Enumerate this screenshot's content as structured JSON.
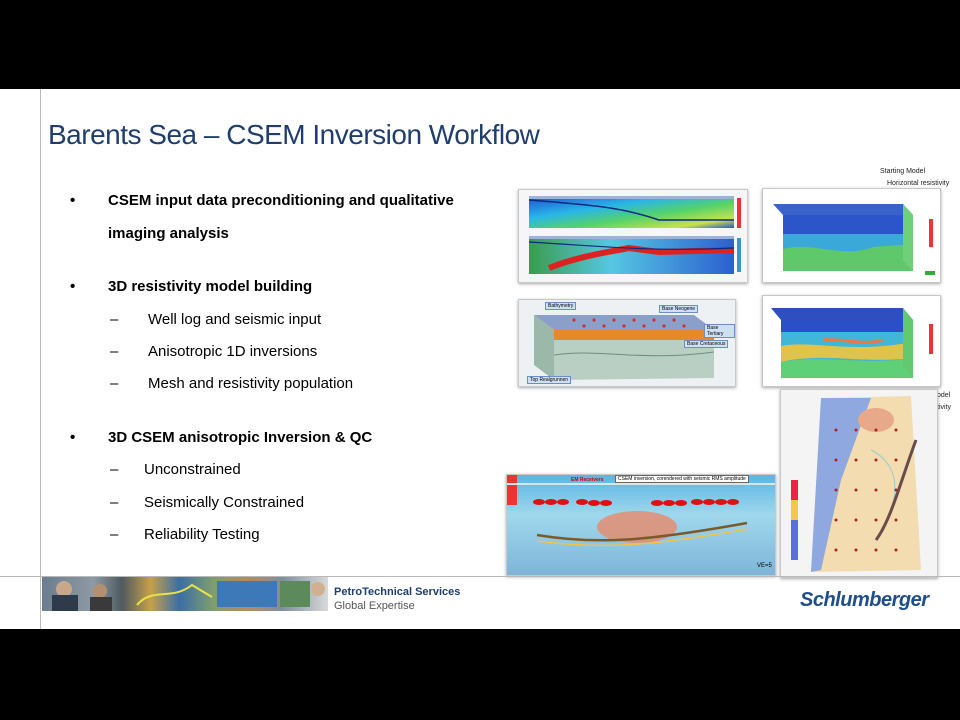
{
  "slide": {
    "title": "Barents Sea – CSEM Inversion Workflow",
    "bullet_marker": "•",
    "dash_marker": "–",
    "bullets": [
      {
        "line1": "CSEM input data preconditioning and qualitative",
        "line2": "imaging analysis"
      },
      {
        "text": "3D resistivity model building",
        "sub": [
          "Well log and seismic input",
          "Anisotropic 1D inversions",
          "Mesh and resistivity population"
        ]
      },
      {
        "text": "3D CSEM anisotropic Inversion & QC",
        "sub": [
          "Unconstrained",
          "Seismically Constrained",
          "Reliability Testing"
        ]
      }
    ]
  },
  "figures": {
    "starting_model_label": "Starting Model",
    "horizontal_resistivity_label": "Horizontal resistivity",
    "cut_label_1": "odel",
    "cut_label_2": "tivity",
    "model_labels": [
      "Bathymetry",
      "Base Neogene",
      "Base Tertiary",
      "Base Cretaceous",
      "Top Realgrunnen"
    ],
    "inversion_caption": "CSEM inversion, corendered with seismic RMS amplitude",
    "receivers_label": "EM Receivers",
    "ve_label": "VE=5"
  },
  "footer": {
    "line1": "PetroTechnical Services",
    "line2": "Global Expertise",
    "logo": "Schlumberger"
  },
  "colors": {
    "title": "#1f3e6e",
    "accent": "#1f4e8c"
  }
}
